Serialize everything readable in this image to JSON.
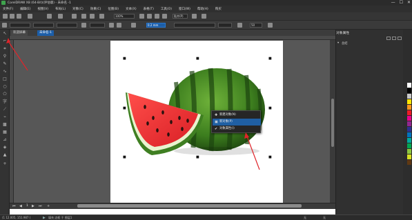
{
  "window": {
    "title": "CorelDRAW X8 (64-Bit)(评估版) - 未命名 -1",
    "controls": [
      "—",
      "☐",
      "✕"
    ]
  },
  "menu": [
    "文件(F)",
    "编辑(E)",
    "视图(V)",
    "布局(L)",
    "对象(C)",
    "效果(C)",
    "位图(B)",
    "文本(X)",
    "表格(T)",
    "工具(O)",
    "窗口(W)",
    "帮助(H)",
    "购买"
  ],
  "toolbar": {
    "zoom": "100%",
    "snap_label": "贴齐(P)",
    "outline_width": "0.2 mm",
    "corner_value": "50"
  },
  "tabs": {
    "welcome": "欢迎屏幕",
    "document": "未命名-1"
  },
  "context_menu": {
    "items": [
      {
        "label": "新建对象(N)",
        "icon": "new-object-icon",
        "highlighted": false
      },
      {
        "label": "新对象(P)",
        "icon": "object-icon",
        "highlighted": true
      },
      {
        "label": "对象属性(I)",
        "icon": "check-icon",
        "highlighted": false
      }
    ]
  },
  "docker": {
    "title": "对象属性",
    "section": "总结"
  },
  "pagebar": {
    "page_label": "1"
  },
  "status": {
    "coords": "(1 12.005, 151.987 )",
    "fill_info": "填充 边框 于 图层1",
    "none_label": "无"
  },
  "colors": {
    "accent": "#1c5ea8",
    "annotation_arrow": "#e0242a",
    "palette": [
      "#ffffff",
      "#000000",
      "#c8c8c8",
      "#ffe600",
      "#f7941d",
      "#ed1c24",
      "#ec008c",
      "#92278f",
      "#2e3192",
      "#0072bc",
      "#00a99d",
      "#00a651",
      "#8dc63f",
      "#d7df23",
      "#603913"
    ]
  }
}
